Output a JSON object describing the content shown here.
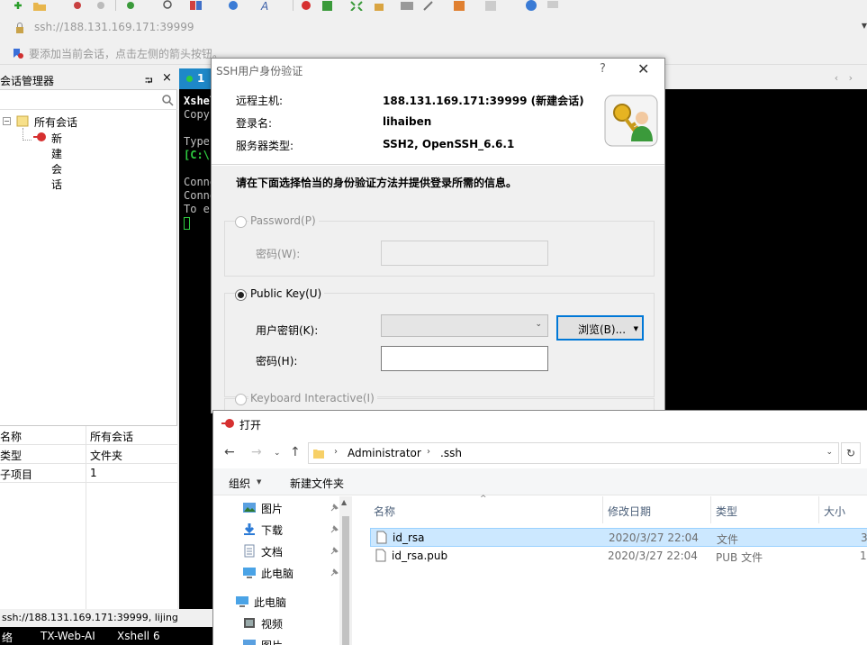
{
  "address_bar": {
    "url": "ssh://188.131.169.171:39999"
  },
  "hint_bar": {
    "text": "要添加当前会话，点击左侧的箭头按钮。"
  },
  "session_manager": {
    "title": "会话管理器",
    "pin": "⮒",
    "close": "×",
    "tree": {
      "root": "所有会话",
      "child": "新建会话",
      "expander": "−"
    },
    "properties": [
      {
        "key": "名称",
        "value": "所有会话"
      },
      {
        "key": "类型",
        "value": "文件夹"
      },
      {
        "key": "子项目",
        "value": "1"
      }
    ],
    "status": "ssh://188.131.169.171:39999, lijing"
  },
  "terminal": {
    "tab_label": "1",
    "tab_nav": "‹ ›",
    "lines": [
      "Xshel",
      "Copyr",
      "",
      "Type ",
      "[C:\\-",
      "",
      "Conne",
      "Conne",
      "To es"
    ]
  },
  "bottom_status": {
    "left": "络",
    "middle": "TX-Web-AI",
    "right": "Xshell 6"
  },
  "ssh_dialog": {
    "title": "SSH用户身份验证",
    "help": "?",
    "close": "✕",
    "remote_host_label": "远程主机:",
    "remote_host_value": "188.131.169.171:39999 (新建会话)",
    "login_label": "登录名:",
    "login_value": "lihaiben",
    "server_type_label": "服务器类型:",
    "server_type_value": "SSH2, OpenSSH_6.6.1",
    "instruction": "请在下面选择恰当的身份验证方法并提供登录所需的信息。",
    "password_option": "Password(P)",
    "password_field_label": "密码(W):",
    "public_key_option": "Public Key(U)",
    "user_key_label": "用户密钥(K):",
    "user_key_value": "",
    "browse_button": "浏览(B)...",
    "passphrase_label": "密码(H):",
    "passphrase_value": "",
    "keyboard_option": "Keyboard Interactive(I)"
  },
  "open_dialog": {
    "title": "打开",
    "path": [
      "Administrator",
      ".ssh"
    ],
    "organize": "组织",
    "new_folder": "新建文件夹",
    "nav_items": [
      {
        "label": "图片",
        "icon": "pictures-icon",
        "pinned": true
      },
      {
        "label": "下载",
        "icon": "download-icon",
        "pinned": true
      },
      {
        "label": "文档",
        "icon": "documents-icon",
        "pinned": true
      },
      {
        "label": "此电脑",
        "icon": "this-pc-icon",
        "pinned": true
      },
      {
        "label": "此电脑",
        "icon": "this-pc-icon",
        "pinned": false
      },
      {
        "label": "视频",
        "icon": "videos-icon",
        "pinned": false
      },
      {
        "label": "图片",
        "icon": "pictures-icon",
        "pinned": false
      }
    ],
    "columns": {
      "name": "名称",
      "modified": "修改日期",
      "type": "类型",
      "size": "大小"
    },
    "files": [
      {
        "name": "id_rsa",
        "modified": "2020/3/27 22:04",
        "type": "文件",
        "size": "3",
        "selected": true
      },
      {
        "name": "id_rsa.pub",
        "modified": "2020/3/27 22:04",
        "type": "PUB 文件",
        "size": "1",
        "selected": false
      }
    ]
  },
  "colors": {
    "tab_active": "#1e88c8",
    "selection": "#cce8ff",
    "focus_border": "#0078d7",
    "terminal_bg": "#000000",
    "terminal_green": "#2ecc40"
  }
}
